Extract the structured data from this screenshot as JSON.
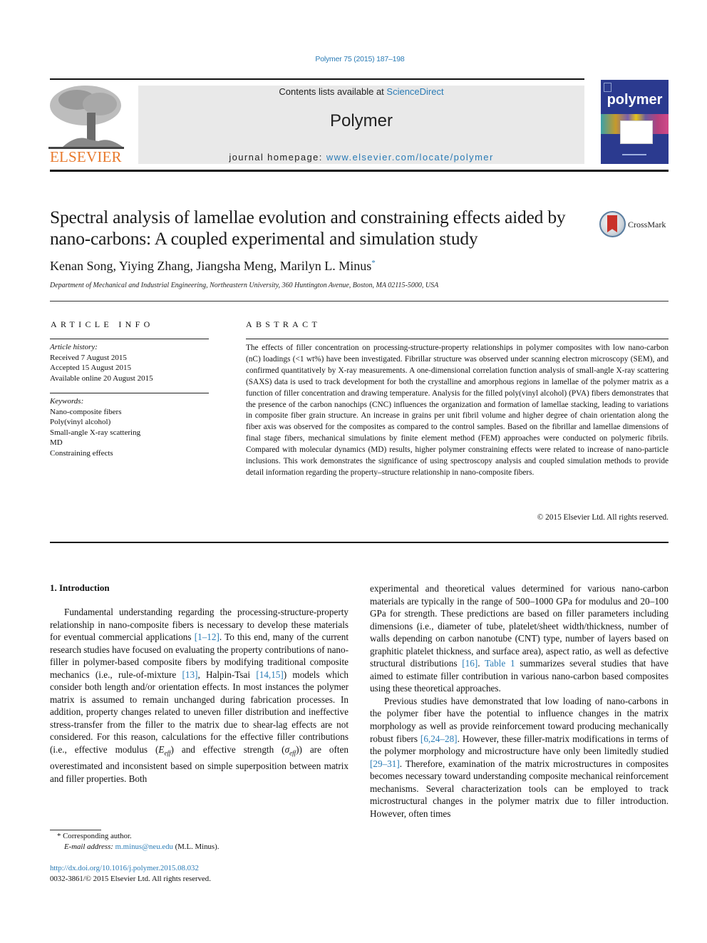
{
  "header": {
    "journal_ref": "Polymer 75 (2015) 187–198",
    "contents_prefix": "Contents lists available at ",
    "contents_link": "ScienceDirect",
    "journal_name": "Polymer",
    "homepage_prefix": "journal homepage: ",
    "homepage_url": "www.elsevier.com/locate/polymer",
    "publisher_logo_text": "ELSEVIER",
    "cover_title": "polymer",
    "colors": {
      "link": "#2a7bb5",
      "elsevier_orange": "#e8792c",
      "cover_blue": "#2b3a8f",
      "masthead_bg": "#e9e9e9"
    }
  },
  "article": {
    "title": "Spectral analysis of lamellae evolution and constraining effects aided by nano-carbons: A coupled experimental and simulation study",
    "crossmark_label": "CrossMark",
    "authors": "Kenan Song, Yiying Zhang, Jiangsha Meng, Marilyn L. Minus",
    "author_mark": "*",
    "affiliation": "Department of Mechanical and Industrial Engineering, Northeastern University, 360 Huntington Avenue, Boston, MA 02115-5000, USA"
  },
  "article_info": {
    "heading": "ARTICLE INFO",
    "history_label": "Article history:",
    "history": [
      "Received 7 August 2015",
      "Accepted 15 August 2015",
      "Available online 20 August 2015"
    ],
    "keywords_label": "Keywords:",
    "keywords": [
      "Nano-composite fibers",
      "Poly(vinyl alcohol)",
      "Small-angle X-ray scattering",
      "MD",
      "Constraining effects"
    ]
  },
  "abstract": {
    "heading": "ABSTRACT",
    "text": "The effects of filler concentration on processing-structure-property relationships in polymer composites with low nano-carbon (nC) loadings (<1 wt%) have been investigated. Fibrillar structure was observed under scanning electron microscopy (SEM), and confirmed quantitatively by X-ray measurements. A one-dimensional correlation function analysis of small-angle X-ray scattering (SAXS) data is used to track development for both the crystalline and amorphous regions in lamellae of the polymer matrix as a function of filler concentration and drawing temperature. Analysis for the filled poly(vinyl alcohol) (PVA) fibers demonstrates that the presence of the carbon nanochips (CNC) influences the organization and formation of lamellae stacking, leading to variations in composite fiber grain structure. An increase in grains per unit fibril volume and higher degree of chain orientation along the fiber axis was observed for the composites as compared to the control samples. Based on the fibrillar and lamellae dimensions of final stage fibers, mechanical simulations by finite element method (FEM) approaches were conducted on polymeric fibrils. Compared with molecular dynamics (MD) results, higher polymer constraining effects were related to increase of nano-particle inclusions. This work demonstrates the significance of using spectroscopy analysis and coupled simulation methods to provide detail information regarding the property–structure relationship in nano-composite fibers.",
    "copyright": "© 2015 Elsevier Ltd. All rights reserved."
  },
  "body": {
    "intro_heading": "1.  Introduction",
    "left": {
      "p1_a": "Fundamental understanding regarding the processing-structure-property relationship in nano-composite fibers is necessary to develop these materials for eventual commercial applications ",
      "ref1": "[1–12]",
      "p1_b": ". To this end, many of the current research studies have focused on evaluating the property contributions of nano-filler in polymer-based composite fibers by modifying traditional composite mechanics (i.e., rule-of-mixture ",
      "ref2": "[13]",
      "p1_c": ", Halpin-Tsai ",
      "ref3": "[14,15]",
      "p1_d": ") models which consider both length and/or orientation effects. In most instances the polymer matrix is assumed to remain unchanged during fabrication processes. In addition, property changes related to uneven filler distribution and ineffective stress-transfer from the filler to the matrix due to shear-lag effects are not considered. For this reason, calculations for the effective filler contributions (i.e., effective modulus (",
      "e_sym": "E",
      "eff_sub": "eff",
      "p1_e": ") and effective strength (",
      "sigma_sym": "σ",
      "p1_f": ")) are often overestimated and inconsistent based on simple superposition between matrix and filler properties. Both"
    },
    "right": {
      "p1_a": "experimental and theoretical values determined for various nano-carbon materials are typically in the range of 500–1000 GPa for modulus and 20–100 GPa for strength. These predictions are based on filler parameters including dimensions (i.e., diameter of tube, platelet/sheet width/thickness, number of walls depending on carbon nanotube (CNT) type, number of layers based on graphitic platelet thickness, and surface area), aspect ratio, as well as defective structural distributions ",
      "ref1": "[16]",
      "p1_b": ". ",
      "table_ref": "Table 1",
      "p1_c": " summarizes several studies that have aimed to estimate filler contribution in various nano-carbon based composites using these theoretical approaches.",
      "p2_a": "Previous studies have demonstrated that low loading of nano-carbons in the polymer fiber have the potential to influence changes in the matrix morphology as well as provide reinforcement toward producing mechanically robust fibers ",
      "ref2": "[6,24–28]",
      "p2_b": ". However, these filler-matrix modifications in terms of the polymer morphology and microstructure have only been limitedly studied ",
      "ref3": "[29–31]",
      "p2_c": ". Therefore, examination of the matrix microstructures in composites becomes necessary toward understanding composite mechanical reinforcement mechanisms. Several characterization tools can be employed to track microstructural changes in the polymer matrix due to filler introduction. However, often times"
    }
  },
  "footnote": {
    "mark": "*",
    "corresponding": " Corresponding author.",
    "email_label": "E-mail address:",
    "email": "m.minus@neu.edu",
    "email_suffix": " (M.L. Minus).",
    "doi": "http://dx.doi.org/10.1016/j.polymer.2015.08.032",
    "issn_line": "0032-3861/© 2015 Elsevier Ltd. All rights reserved."
  }
}
